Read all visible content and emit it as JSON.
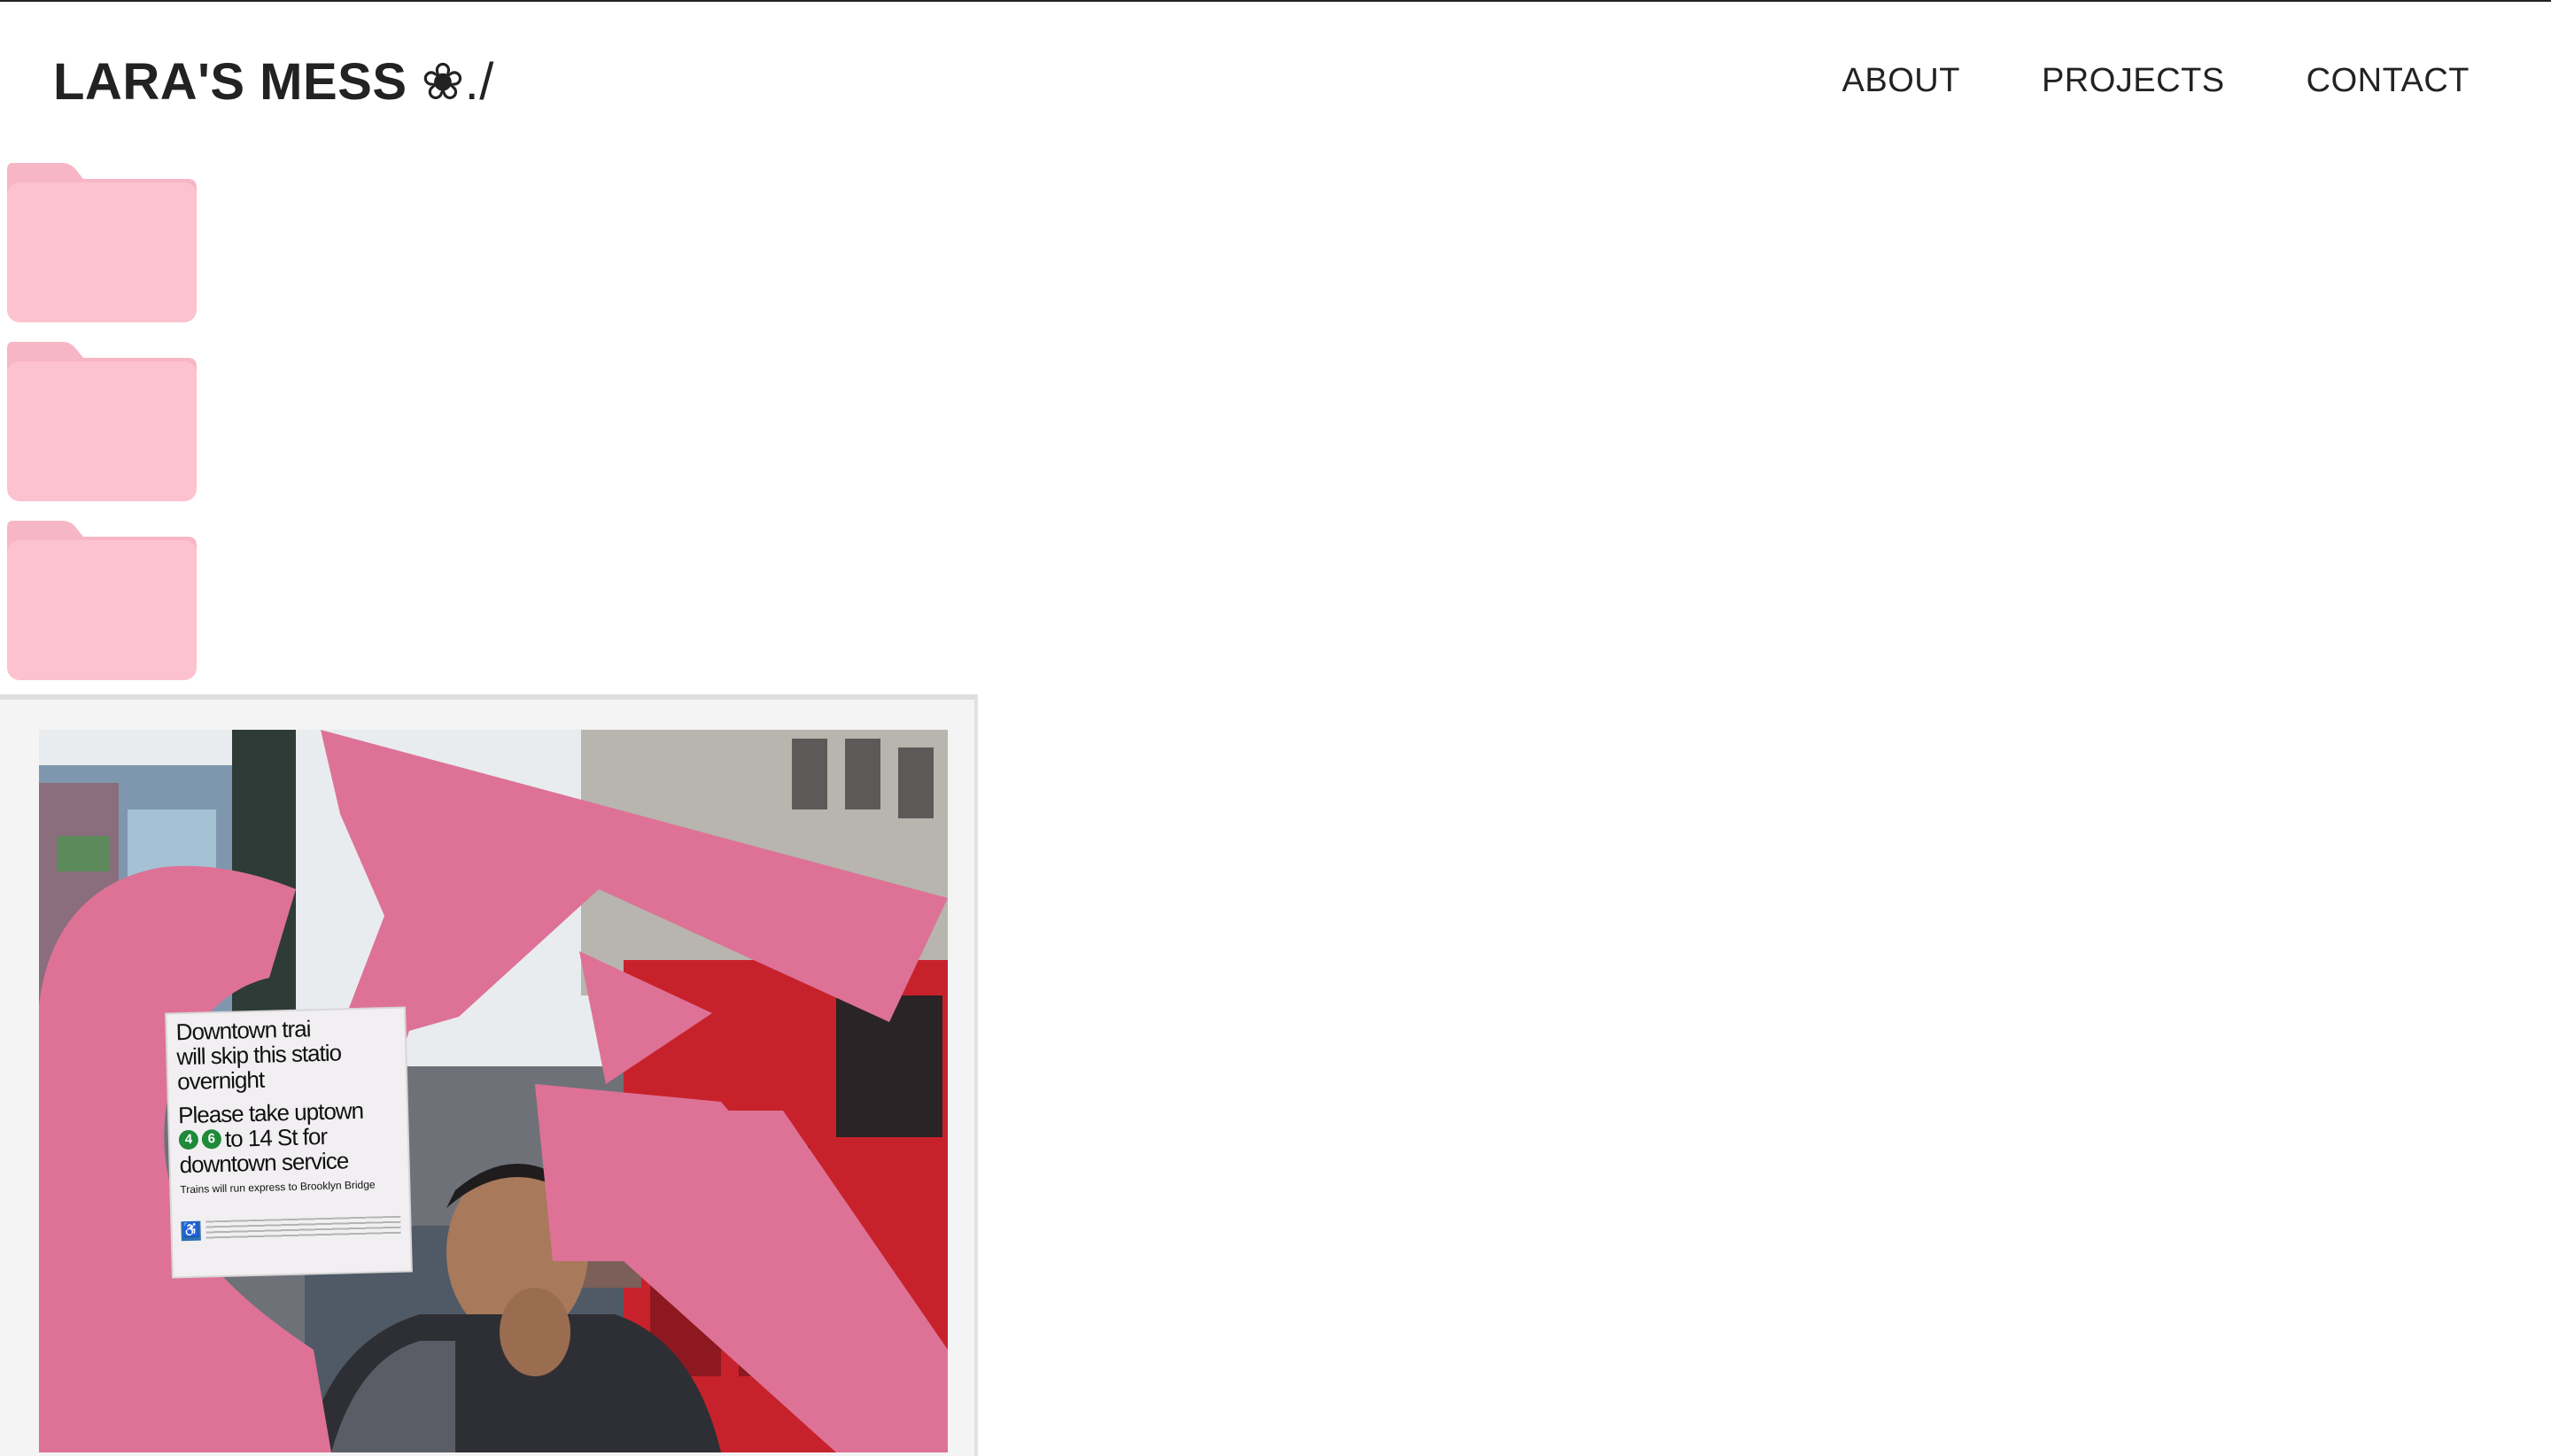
{
  "site": {
    "logo_text": "LARA'S MESS",
    "logo_mark": "❀./"
  },
  "nav": {
    "items": [
      {
        "label": "ABOUT"
      },
      {
        "label": "PROJECTS"
      },
      {
        "label": "CONTACT"
      }
    ]
  },
  "folders": [
    {
      "icon": "folder-icon"
    },
    {
      "icon": "folder-icon"
    },
    {
      "icon": "folder-icon"
    }
  ],
  "colors": {
    "folder_back": "#f7b6c5",
    "folder_front": "#fcc2cf",
    "accent_pink": "#dd7296"
  },
  "poster": {
    "line1": "Downtown trai",
    "line2": "will skip this statio",
    "line3": "overnight",
    "line4": "Please take uptown",
    "route_a": "4",
    "route_b": "6",
    "line5_rest": "to 14 St for",
    "line6": "downtown service",
    "small": "Trains will run express to Brooklyn Bridge"
  }
}
